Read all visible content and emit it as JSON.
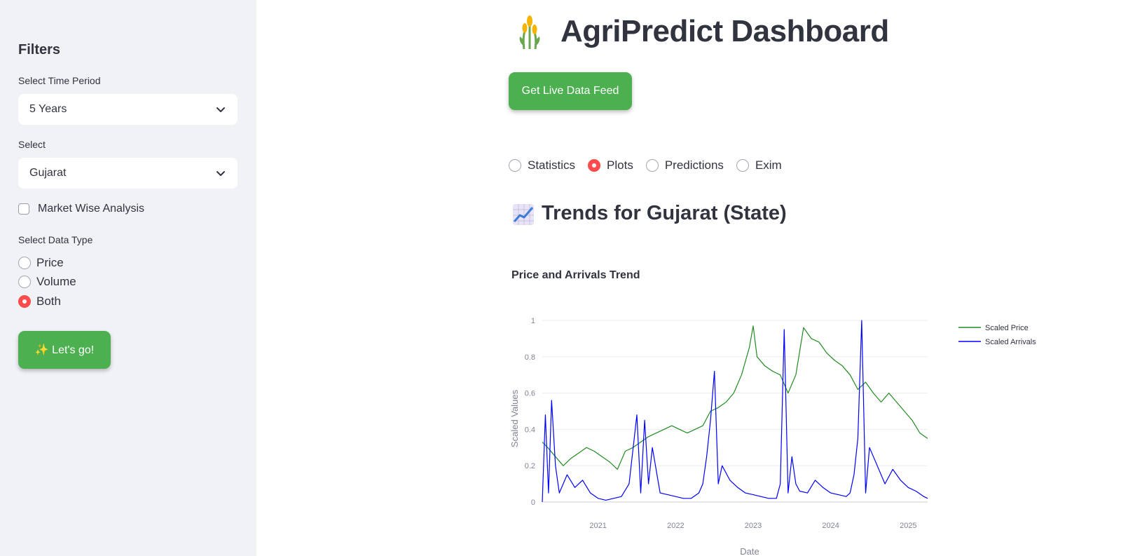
{
  "sidebar": {
    "title": "Filters",
    "time_period_label": "Select Time Period",
    "time_period_value": "5 Years",
    "select_label": "Select",
    "select_value": "Gujarat",
    "market_checkbox_label": "Market Wise Analysis",
    "data_type_label": "Select Data Type",
    "data_type_options": [
      "Price",
      "Volume",
      "Both"
    ],
    "data_type_selected": "Both",
    "go_button_label": "✨ Let's go!"
  },
  "main": {
    "title": "AgriPredict Dashboard",
    "live_button_label": "Get Live Data Feed",
    "tabs": [
      "Statistics",
      "Plots",
      "Predictions",
      "Exim"
    ],
    "tab_selected": "Plots",
    "section_heading": "Trends for Gujarat (State)"
  },
  "colors": {
    "accent_green": "#4caf50",
    "radio_selected": "#ff4b4b",
    "sidebar_bg": "#f0f2f6",
    "price_line": "#228b22",
    "arrivals_line": "#0000ff"
  },
  "chart_data": {
    "type": "line",
    "title": "Price and Arrivals Trend",
    "xlabel": "Date",
    "ylabel": "Scaled Values",
    "xlim": [
      2020.28,
      2025.25
    ],
    "ylim": [
      0,
      1
    ],
    "x_ticks": [
      "2021",
      "2022",
      "2023",
      "2024",
      "2025"
    ],
    "y_ticks": [
      "0",
      "0.2",
      "0.4",
      "0.6",
      "0.8",
      "1"
    ],
    "legend_position": "top-right",
    "grid": true,
    "series": [
      {
        "name": "Scaled Price",
        "color": "#228b22",
        "x": [
          2020.28,
          2020.35,
          2020.45,
          2020.55,
          2020.65,
          2020.75,
          2020.85,
          2020.95,
          2021.05,
          2021.15,
          2021.25,
          2021.35,
          2021.45,
          2021.55,
          2021.65,
          2021.75,
          2021.85,
          2021.95,
          2022.05,
          2022.15,
          2022.25,
          2022.35,
          2022.45,
          2022.55,
          2022.65,
          2022.75,
          2022.85,
          2022.95,
          2023.0,
          2023.05,
          2023.15,
          2023.25,
          2023.35,
          2023.45,
          2023.55,
          2023.65,
          2023.75,
          2023.85,
          2023.95,
          2024.05,
          2024.15,
          2024.25,
          2024.35,
          2024.45,
          2024.55,
          2024.65,
          2024.75,
          2024.85,
          2024.95,
          2025.05,
          2025.15,
          2025.25
        ],
        "y": [
          0.33,
          0.3,
          0.25,
          0.2,
          0.24,
          0.27,
          0.3,
          0.28,
          0.25,
          0.22,
          0.18,
          0.28,
          0.3,
          0.33,
          0.36,
          0.38,
          0.4,
          0.42,
          0.4,
          0.38,
          0.4,
          0.42,
          0.5,
          0.52,
          0.55,
          0.6,
          0.7,
          0.85,
          0.97,
          0.8,
          0.75,
          0.72,
          0.7,
          0.6,
          0.7,
          0.96,
          0.9,
          0.88,
          0.82,
          0.78,
          0.75,
          0.7,
          0.62,
          0.66,
          0.6,
          0.55,
          0.6,
          0.55,
          0.5,
          0.45,
          0.38,
          0.35
        ]
      },
      {
        "name": "Scaled Arrivals",
        "color": "#0000ff",
        "x": [
          2020.28,
          2020.32,
          2020.36,
          2020.4,
          2020.45,
          2020.5,
          2020.6,
          2020.7,
          2020.8,
          2020.9,
          2021.0,
          2021.1,
          2021.2,
          2021.3,
          2021.4,
          2021.5,
          2021.55,
          2021.6,
          2021.65,
          2021.7,
          2021.8,
          2021.9,
          2022.0,
          2022.1,
          2022.2,
          2022.3,
          2022.35,
          2022.4,
          2022.45,
          2022.5,
          2022.55,
          2022.6,
          2022.7,
          2022.8,
          2022.9,
          2023.0,
          2023.1,
          2023.2,
          2023.3,
          2023.35,
          2023.4,
          2023.45,
          2023.5,
          2023.55,
          2023.6,
          2023.7,
          2023.8,
          2023.9,
          2024.0,
          2024.1,
          2024.2,
          2024.25,
          2024.3,
          2024.35,
          2024.4,
          2024.45,
          2024.5,
          2024.6,
          2024.7,
          2024.8,
          2024.9,
          2025.0,
          2025.1,
          2025.2,
          2025.25
        ],
        "y": [
          0.0,
          0.48,
          0.05,
          0.56,
          0.2,
          0.05,
          0.15,
          0.08,
          0.12,
          0.05,
          0.02,
          0.01,
          0.02,
          0.03,
          0.1,
          0.48,
          0.05,
          0.45,
          0.1,
          0.3,
          0.05,
          0.04,
          0.03,
          0.02,
          0.02,
          0.05,
          0.1,
          0.25,
          0.45,
          0.72,
          0.1,
          0.2,
          0.12,
          0.08,
          0.05,
          0.04,
          0.03,
          0.02,
          0.02,
          0.1,
          0.95,
          0.05,
          0.25,
          0.1,
          0.06,
          0.05,
          0.12,
          0.08,
          0.05,
          0.04,
          0.03,
          0.05,
          0.15,
          0.35,
          1.0,
          0.05,
          0.3,
          0.2,
          0.1,
          0.18,
          0.12,
          0.08,
          0.06,
          0.03,
          0.02
        ]
      }
    ]
  }
}
